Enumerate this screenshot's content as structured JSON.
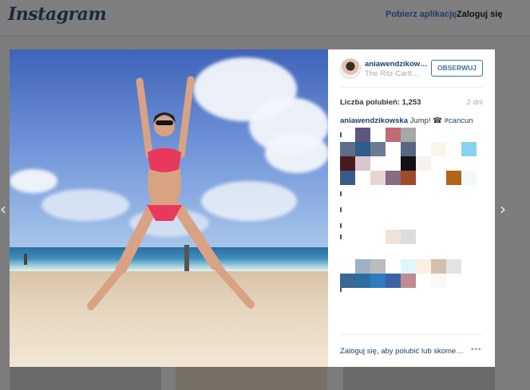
{
  "header": {
    "logo": "Instagram",
    "get_app": "Pobierz aplikację",
    "login": "Zaloguj się"
  },
  "nav": {
    "prev_icon": "chevron-left-icon",
    "next_icon": "chevron-right-icon",
    "prev": "‹",
    "next": "›"
  },
  "post": {
    "username": "aniawendzikowska",
    "location": "The Ritz-Carlton, Cancun",
    "follow_label": "OBSERWUJ",
    "likes": "Liczba polubień: 1,253",
    "age": "2 dni",
    "caption_user": "aniawendzikowska",
    "caption_text": " Jump! ☎ ",
    "caption_tag": "#cancun",
    "login_prompt": "Zaloguj się, aby polubić lub skomentować.",
    "more": "•••"
  },
  "colors": {
    "accent": "#3f729b",
    "link": "#1e3f66"
  }
}
